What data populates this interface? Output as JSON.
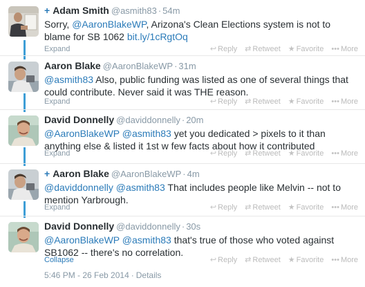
{
  "tweets": [
    {
      "plus": "+",
      "fullname": "Adam Smith",
      "username": "@asmith83",
      "time": "54m",
      "text_parts": [
        "Sorry, ",
        "@AaronBlakeWP",
        ", Arizona's Clean Elections system is not to blame for SB 1062 ",
        "bit.ly/1cRgtOq"
      ],
      "toggle": "Expand"
    },
    {
      "plus": "",
      "fullname": "Aaron Blake",
      "username": "@AaronBlakeWP",
      "time": "31m",
      "text_parts": [
        "@asmith83",
        " Also, public funding was listed as one of several things that could contribute. Never said it was THE reason."
      ],
      "toggle": "Expand"
    },
    {
      "plus": "",
      "fullname": "David Donnelly",
      "username": "@daviddonnelly",
      "time": "20m",
      "text_parts": [
        "@AaronBlakeWP",
        " ",
        "@asmith83",
        " yet you dedicated > pixels to it than anything else & listed it 1st w few facts about how it contributed"
      ],
      "toggle": "Expand"
    },
    {
      "plus": "+",
      "fullname": "Aaron Blake",
      "username": "@AaronBlakeWP",
      "time": "4m",
      "text_parts": [
        "@daviddonnelly",
        " ",
        "@asmith83",
        " That includes people like Melvin -- not to mention Yarbrough."
      ],
      "toggle": "Expand"
    },
    {
      "plus": "",
      "fullname": "David Donnelly",
      "username": "@daviddonnelly",
      "time": "30s",
      "text_parts": [
        "@AaronBlakeWP",
        " ",
        "@asmith83",
        " that's true of those who voted against SB1062 -- there's no correlation."
      ],
      "toggle": "Collapse"
    }
  ],
  "actions": {
    "reply": "Reply",
    "retweet": "Retweet",
    "favorite": "Favorite",
    "more": "More"
  },
  "timestamp": {
    "datetime": "5:46 PM - 26 Feb 2014",
    "separator": "·",
    "details": "Details"
  },
  "header_separator": "·",
  "colors": {
    "link": "#2b7bb9",
    "thread_line": "#3e9ed6",
    "muted": "#8899a6",
    "text": "#292f33"
  }
}
